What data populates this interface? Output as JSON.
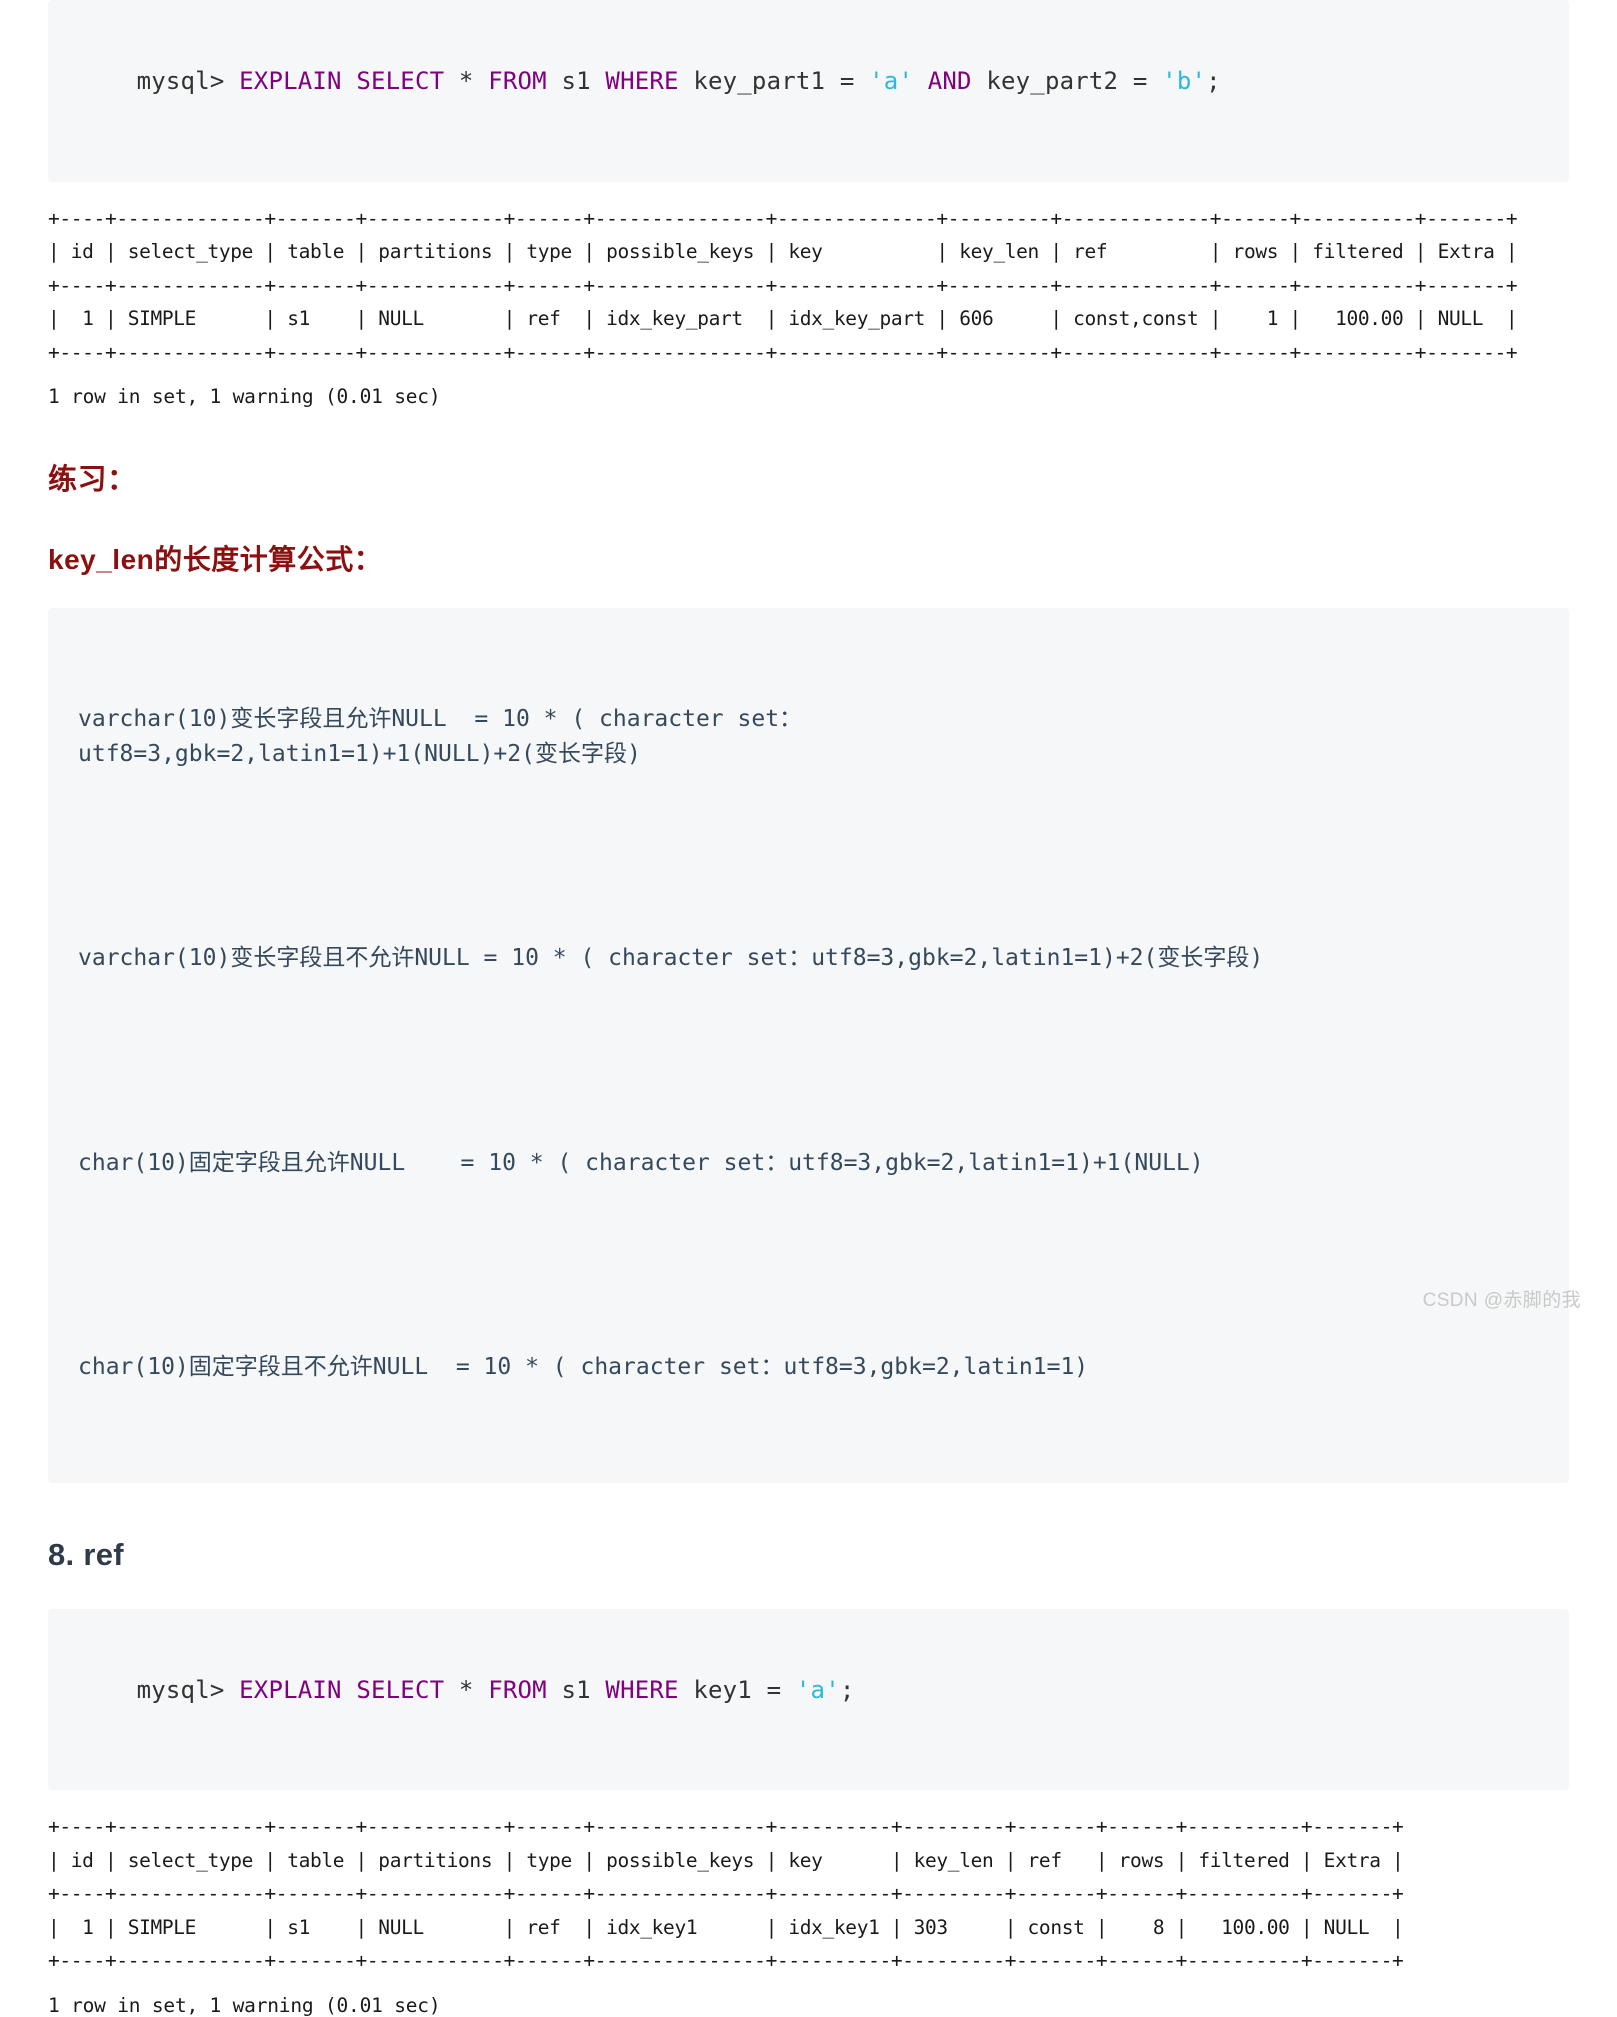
{
  "theme": {
    "page_bg": "#ffffff",
    "code_bg": "#f6f7f8",
    "code_text": "#35495c",
    "keyword_color": "#800080",
    "string_color": "#2db7dd",
    "heading_red": "#8b1111",
    "heading_dark": "#2f3b4a",
    "watermark_color": "#c9c9c9"
  },
  "sql_block_1": {
    "prompt": "mysql> ",
    "kw_explain_select": "EXPLAIN SELECT ",
    "star": "* ",
    "kw_from": "FROM ",
    "table": "s1 ",
    "kw_where": "WHERE ",
    "col1": "key_part1 ",
    "eq1": "= ",
    "val1": "'a' ",
    "kw_and": "AND ",
    "col2": "key_part2 ",
    "eq2": "= ",
    "val2": "'b'",
    "semicolon": ";",
    "full_text": "mysql> EXPLAIN SELECT * FROM s1 WHERE key_part1 = 'a' AND key_part2 = 'b';"
  },
  "explain_output_1": {
    "ascii": "+----+-------------+-------+------------+------+---------------+--------------+---------+-------------+------+----------+-------+\n| id | select_type | table | partitions | type | possible_keys | key          | key_len | ref         | rows | filtered | Extra |\n+----+-------------+-------+------------+------+---------------+--------------+---------+-------------+------+----------+-------+\n|  1 | SIMPLE      | s1    | NULL       | ref  | idx_key_part  | idx_key_part | 606     | const,const |    1 |   100.00 | NULL  |\n+----+-------------+-------+------------+------+---------------+--------------+---------+-------------+------+----------+-------+",
    "columns": [
      "id",
      "select_type",
      "table",
      "partitions",
      "type",
      "possible_keys",
      "key",
      "key_len",
      "ref",
      "rows",
      "filtered",
      "Extra"
    ],
    "rows": [
      [
        "1",
        "SIMPLE",
        "s1",
        "NULL",
        "ref",
        "idx_key_part",
        "idx_key_part",
        "606",
        "const,const",
        "1",
        "100.00",
        "NULL"
      ]
    ],
    "status": "1 row in set, 1 warning (0.01 sec)"
  },
  "heading_exercise": "练习：",
  "heading_keylen_formula": "key_len的长度计算公式：",
  "formula_block": {
    "lines": [
      "varchar(10)变长字段且允许NULL  = 10 * ( character set：\nutf8=3,gbk=2,latin1=1)+1(NULL)+2(变长字段)",
      "varchar(10)变长字段且不允许NULL = 10 * ( character set：utf8=3,gbk=2,latin1=1)+2(变长字段)",
      "char(10)固定字段且允许NULL    = 10 * ( character set：utf8=3,gbk=2,latin1=1)+1(NULL)",
      "char(10)固定字段且不允许NULL  = 10 * ( character set：utf8=3,gbk=2,latin1=1)"
    ]
  },
  "heading_ref": "8. ref",
  "sql_block_2": {
    "prompt": "mysql> ",
    "kw_explain_select": "EXPLAIN SELECT ",
    "star": "* ",
    "kw_from": "FROM ",
    "table": "s1 ",
    "kw_where": "WHERE ",
    "col1": "key1 ",
    "eq1": "= ",
    "val1": "'a'",
    "semicolon": ";",
    "full_text": "mysql> EXPLAIN SELECT * FROM s1 WHERE key1 = 'a';"
  },
  "explain_output_2": {
    "ascii": "+----+-------------+-------+------------+------+---------------+----------+---------+-------+------+----------+-------+\n| id | select_type | table | partitions | type | possible_keys | key      | key_len | ref   | rows | filtered | Extra |\n+----+-------------+-------+------------+------+---------------+----------+---------+-------+------+----------+-------+\n|  1 | SIMPLE      | s1    | NULL       | ref  | idx_key1      | idx_key1 | 303     | const |    8 |   100.00 | NULL  |\n+----+-------------+-------+------------+------+---------------+----------+---------+-------+------+----------+-------+",
    "columns": [
      "id",
      "select_type",
      "table",
      "partitions",
      "type",
      "possible_keys",
      "key",
      "key_len",
      "ref",
      "rows",
      "filtered",
      "Extra"
    ],
    "rows": [
      [
        "1",
        "SIMPLE",
        "s1",
        "NULL",
        "ref",
        "idx_key1",
        "idx_key1",
        "303",
        "const",
        "8",
        "100.00",
        "NULL"
      ]
    ],
    "status": "1 row in set, 1 warning (0.01 sec)"
  },
  "watermark": "CSDN @赤脚的我"
}
